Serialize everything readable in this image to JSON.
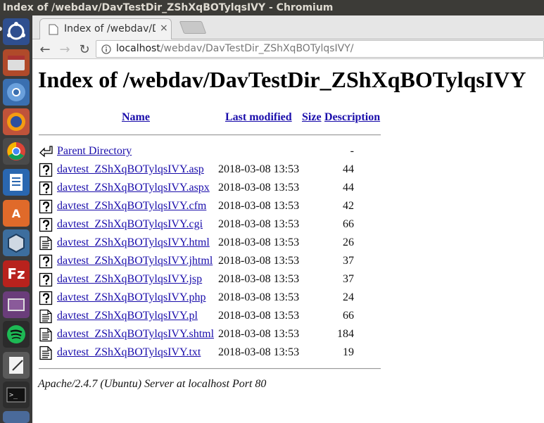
{
  "window": {
    "title": "Index of /webdav/DavTestDir_ZShXqBOTylqsIVY - Chromium"
  },
  "launcher": {
    "items": [
      "ubuntu-dash",
      "files",
      "chromium",
      "firefox",
      "chrome",
      "libreoffice-writer",
      "software-center",
      "virtualbox",
      "filezilla",
      "video",
      "spotify",
      "text-editor",
      "terminal",
      "more"
    ]
  },
  "browser": {
    "tab_title": "Index of /webdav/D",
    "tab_close": "×",
    "back": "←",
    "forward": "→",
    "reload": "↻",
    "url_host": "localhost",
    "url_path": "/webdav/DavTestDir_ZShXqBOTylqsIVY/"
  },
  "page": {
    "heading": "Index of /webdav/DavTestDir_ZShXqBOTylqsIVY",
    "columns": {
      "name": "Name",
      "modified": "Last modified",
      "size": "Size",
      "description": "Description"
    },
    "parent": {
      "label": "Parent Directory",
      "size": "-"
    },
    "files": [
      {
        "name": "davtest_ZShXqBOTylqsIVY.asp",
        "modified": "2018-03-08 13:53",
        "size": "44",
        "icon": "unknown"
      },
      {
        "name": "davtest_ZShXqBOTylqsIVY.aspx",
        "modified": "2018-03-08 13:53",
        "size": "44",
        "icon": "unknown"
      },
      {
        "name": "davtest_ZShXqBOTylqsIVY.cfm",
        "modified": "2018-03-08 13:53",
        "size": "42",
        "icon": "unknown"
      },
      {
        "name": "davtest_ZShXqBOTylqsIVY.cgi",
        "modified": "2018-03-08 13:53",
        "size": "66",
        "icon": "unknown"
      },
      {
        "name": "davtest_ZShXqBOTylqsIVY.html",
        "modified": "2018-03-08 13:53",
        "size": "26",
        "icon": "text"
      },
      {
        "name": "davtest_ZShXqBOTylqsIVY.jhtml",
        "modified": "2018-03-08 13:53",
        "size": "37",
        "icon": "unknown"
      },
      {
        "name": "davtest_ZShXqBOTylqsIVY.jsp",
        "modified": "2018-03-08 13:53",
        "size": "37",
        "icon": "unknown"
      },
      {
        "name": "davtest_ZShXqBOTylqsIVY.php",
        "modified": "2018-03-08 13:53",
        "size": "24",
        "icon": "unknown"
      },
      {
        "name": "davtest_ZShXqBOTylqsIVY.pl",
        "modified": "2018-03-08 13:53",
        "size": "66",
        "icon": "text"
      },
      {
        "name": "davtest_ZShXqBOTylqsIVY.shtml",
        "modified": "2018-03-08 13:53",
        "size": "184",
        "icon": "text"
      },
      {
        "name": "davtest_ZShXqBOTylqsIVY.txt",
        "modified": "2018-03-08 13:53",
        "size": "19",
        "icon": "text"
      }
    ],
    "footer": "Apache/2.4.7 (Ubuntu) Server at localhost Port 80"
  },
  "colors": {
    "link": "#1a0dab",
    "launcher_bg": "#3a3a3a",
    "titlebar_bg": "#3c3b37"
  }
}
